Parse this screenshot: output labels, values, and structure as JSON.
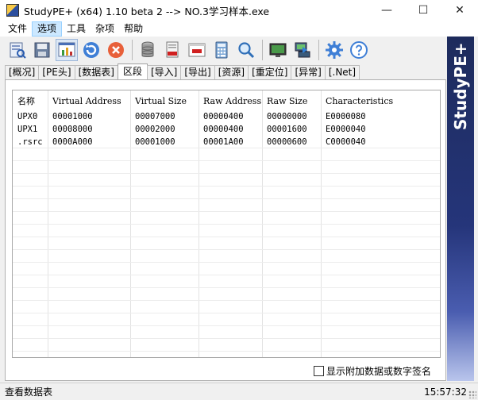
{
  "window": {
    "title": "StudyPE+ (x64) 1.10 beta 2  --> NO.3学习样本.exe",
    "minimize_glyph": "—",
    "maximize_glyph": "☐",
    "close_glyph": "✕"
  },
  "menu": {
    "items": [
      {
        "label": "文件",
        "active": false
      },
      {
        "label": "选项",
        "active": true
      },
      {
        "label": "工具",
        "active": false
      },
      {
        "label": "杂项",
        "active": false
      },
      {
        "label": "帮助",
        "active": false
      }
    ]
  },
  "toolbar": {
    "icons": [
      "open-file-icon",
      "save-icon",
      "chart-icon",
      "refresh-icon",
      "cancel-icon",
      "database-icon",
      "asm-icon",
      "asm-window-icon",
      "calculator-icon",
      "search-icon",
      "monitor-icon",
      "network-icon",
      "gear-icon",
      "help-icon"
    ]
  },
  "tabs": [
    {
      "label": "[概况]",
      "active": false
    },
    {
      "label": "[PE头]",
      "active": false
    },
    {
      "label": "[数据表]",
      "active": false
    },
    {
      "label": "区段",
      "active": true
    },
    {
      "label": "[导入]",
      "active": false
    },
    {
      "label": "[导出]",
      "active": false
    },
    {
      "label": "[资源]",
      "active": false
    },
    {
      "label": "[重定位]",
      "active": false
    },
    {
      "label": "[异常]",
      "active": false
    },
    {
      "label": "[.Net]",
      "active": false
    }
  ],
  "sections_table": {
    "headers": [
      "名称",
      "Virtual Address",
      "Virtual Size",
      "Raw Address",
      "Raw Size",
      "Characteristics"
    ],
    "rows": [
      [
        "UPX0",
        "00001000",
        "00007000",
        "00000400",
        "00000000",
        "E0000080"
      ],
      [
        "UPX1",
        "00008000",
        "00002000",
        "00000400",
        "00001600",
        "E0000040"
      ],
      [
        ".rsrc",
        "0000A000",
        "00001000",
        "00001A00",
        "00000600",
        "C0000040"
      ]
    ]
  },
  "checkbox": {
    "label": "显示附加数据或数字签名",
    "checked": false
  },
  "banner": {
    "text": "StudyPE+"
  },
  "status": {
    "left": "查看数据表",
    "time": "15:57:32"
  }
}
